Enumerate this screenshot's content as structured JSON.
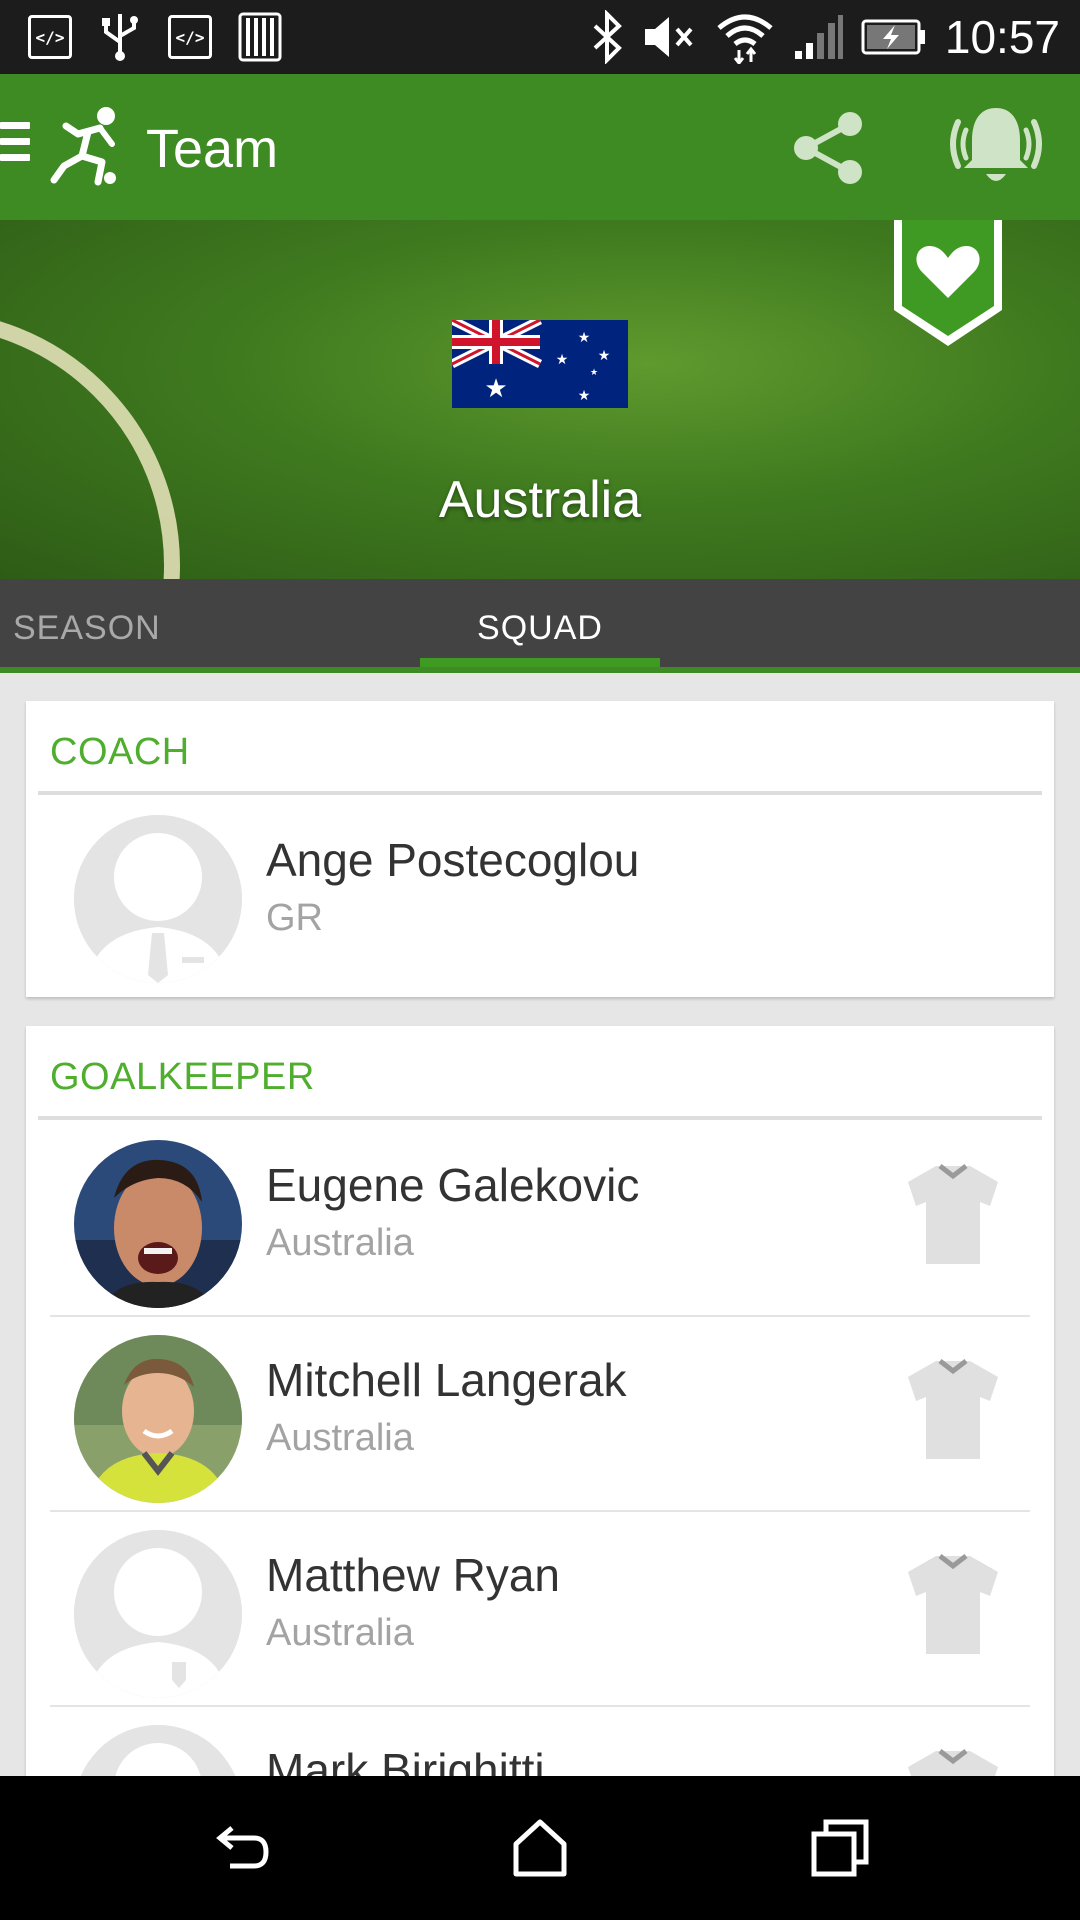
{
  "status_bar": {
    "time": "10:57",
    "left_icons": [
      "code-icon",
      "usb-icon",
      "code-icon",
      "barcode-icon"
    ],
    "right_icons": [
      "bluetooth-icon",
      "mute-icon",
      "wifi-icon",
      "signal-icon",
      "battery-charging-icon"
    ]
  },
  "app_bar": {
    "title": "Team",
    "menu_icon": "hamburger-icon",
    "logo_icon": "soccer-player-icon",
    "actions": [
      "share-icon",
      "alarm-bell-icon"
    ]
  },
  "hero": {
    "team_name": "Australia",
    "flag_icon": "australia-flag-icon",
    "favorite_icon": "heart-icon"
  },
  "tabs": [
    {
      "label": "SEASON",
      "selected": false
    },
    {
      "label": "SQUAD",
      "selected": true
    }
  ],
  "sections": [
    {
      "title": "COACH",
      "people": [
        {
          "name": "Ange Postecoglou",
          "sub": "GR",
          "avatar": "placeholder-coach-avatar"
        }
      ]
    },
    {
      "title": "GOALKEEPER",
      "people": [
        {
          "name": "Eugene Galekovic",
          "sub": "Australia",
          "avatar": "player-photo"
        },
        {
          "name": "Mitchell Langerak",
          "sub": "Australia",
          "avatar": "player-photo"
        },
        {
          "name": "Matthew Ryan",
          "sub": "Australia",
          "avatar": "placeholder-player-avatar"
        },
        {
          "name": "Mark Birighitti",
          "sub": "",
          "avatar": "placeholder-player-avatar"
        }
      ]
    }
  ],
  "colors": {
    "primary": "#3e8a23",
    "accent": "#4fae2e",
    "tab_bar": "#434343"
  },
  "nav_bar": [
    "back-icon",
    "home-icon",
    "recent-apps-icon"
  ]
}
